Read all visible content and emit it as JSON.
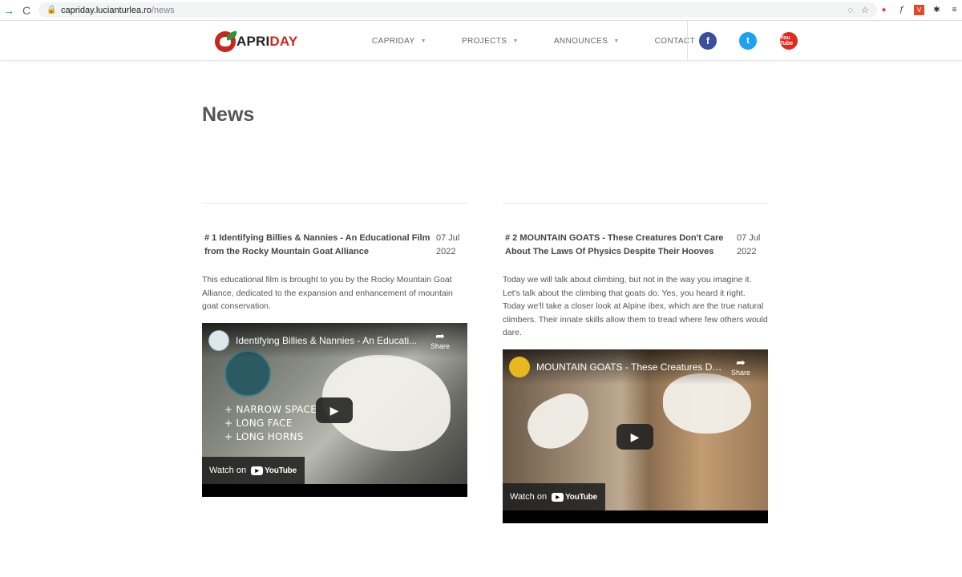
{
  "browser": {
    "url_host": "capriday.lucianturlea.ro",
    "url_path": "/news",
    "back_glyph": "→",
    "reload_glyph": "C"
  },
  "header": {
    "logo_part1": "APRI",
    "logo_part2": "DAY",
    "menu": [
      {
        "label": "CAPRIDAY",
        "caret": "▼"
      },
      {
        "label": "PROJECTS",
        "caret": "▼"
      },
      {
        "label": "ANNOUNCES",
        "caret": "▼"
      },
      {
        "label": "CONTACT"
      }
    ],
    "social": {
      "facebook": "f",
      "twitter": "t",
      "youtube": "You Tube"
    }
  },
  "page": {
    "title": "News"
  },
  "posts": [
    {
      "title": "# 1 Identifying Billies & Nannies - An Educational Film from the Rocky Mountain Goat Alliance",
      "date": "07 Jul 2022",
      "body": "This educational film is brought to you by the Rocky Mountain Goat Alliance, dedicated to the expansion and enhancement of mountain goat conservation.",
      "video": {
        "title": "Identifying Billies & Nannies - An Educati...",
        "share_label": "Share",
        "watch_label": "Watch on",
        "yt_label": "YouTube",
        "overlay": [
          "+ NARROW SPACE",
          "+ LONG FACE",
          "+ LONG HORNS"
        ]
      }
    },
    {
      "title": "# 2 MOUNTAIN GOATS - These Creatures Don't Care About The Laws Of Physics Despite Their Hooves",
      "date": "07 Jul 2022",
      "body": "Today we will talk about climbing, but not in the way you imagine it. Let's talk about the climbing that goats do. Yes, you heard it right. Today we'll take a closer look at Alpine ibex, which are the true natural climbers. Their innate skills allow them to tread where few others would dare.",
      "video": {
        "title": "MOUNTAIN GOATS - These Creatures Do...",
        "share_label": "Share",
        "watch_label": "Watch on",
        "yt_label": "YouTube"
      }
    }
  ],
  "colors": {
    "brand_red": "#d0271f",
    "facebook": "#3b4fa0",
    "twitter": "#1da1f2",
    "youtube": "#e02a1f"
  }
}
